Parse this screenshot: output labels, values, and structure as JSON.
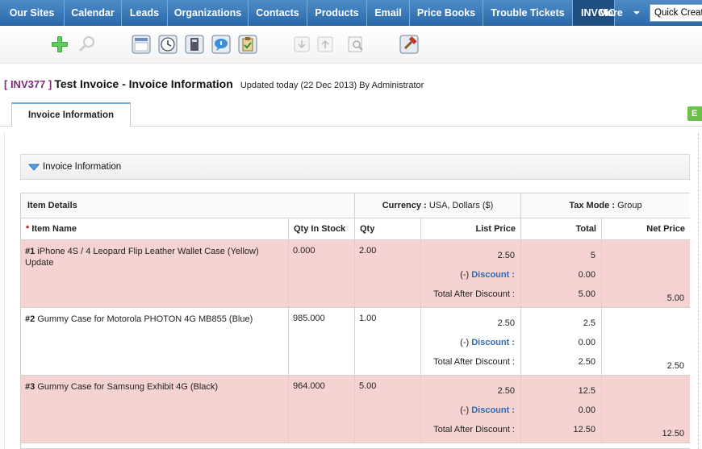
{
  "nav": {
    "tabs": [
      {
        "label": "Our Sites"
      },
      {
        "label": "Calendar"
      },
      {
        "label": "Leads"
      },
      {
        "label": "Organizations"
      },
      {
        "label": "Contacts"
      },
      {
        "label": "Products"
      },
      {
        "label": "Email"
      },
      {
        "label": "Price Books"
      },
      {
        "label": "Trouble Tickets"
      },
      {
        "label": "INVOICE"
      }
    ],
    "more_label": "More",
    "quick_create": "Quick Create"
  },
  "colors": {
    "nav_bg": "#3b7bbf",
    "active_tab": "#1f4f80",
    "highlight_row": "#f5d3d3",
    "record_id": "#7a2a7a",
    "discount_link": "#2e6ab5"
  },
  "toolbar": {
    "icons": [
      "add-icon",
      "search-icon",
      "calendar-icon",
      "clock-icon",
      "calculator-icon",
      "chat-icon",
      "clipboard-icon",
      "import-icon",
      "export-icon",
      "find-duplicates-icon",
      "settings-hammer-icon"
    ]
  },
  "record": {
    "id": "[ INV377 ]",
    "title": "Test Invoice - Invoice Information",
    "updated": "Updated today (22 Dec 2013) By Administrator"
  },
  "tabs": {
    "info": "Invoice Information",
    "edit": "E"
  },
  "section": {
    "title": "Invoice Information"
  },
  "items": {
    "header": {
      "item_details": "Item Details",
      "currency_label": "Currency :",
      "currency_value": "USA, Dollars ($)",
      "taxmode_label": "Tax Mode :",
      "taxmode_value": "Group"
    },
    "columns": {
      "required_mark": "*",
      "item_name": "Item Name",
      "qty_in_stock": "Qty In Stock",
      "qty": "Qty",
      "list_price": "List Price",
      "total": "Total",
      "net_price": "Net Price"
    },
    "labels": {
      "discount_prefix": "(-)",
      "discount": "Discount :",
      "total_after_discount": "Total After Discount :"
    },
    "rows": [
      {
        "num": "#1",
        "name": "iPhone 4S / 4 Leopard Flip Leather Wallet Case (Yellow)",
        "desc": "Update",
        "stock": "0.000",
        "qty": "2.00",
        "list_price": "2.50",
        "total": "5",
        "discount": "0.00",
        "after_discount": "5.00",
        "net": "5.00"
      },
      {
        "num": "#2",
        "name": "Gummy Case for Motorola PHOTON 4G MB855 (Blue)",
        "desc": "",
        "stock": "985.000",
        "qty": "1.00",
        "list_price": "2.50",
        "total": "2.5",
        "discount": "0.00",
        "after_discount": "2.50",
        "net": "2.50"
      },
      {
        "num": "#3",
        "name": "Gummy Case for Samsung Exhibit 4G (Black)",
        "desc": "",
        "stock": "964.000",
        "qty": "5.00",
        "list_price": "2.50",
        "total": "12.5",
        "discount": "0.00",
        "after_discount": "12.50",
        "net": "12.50"
      }
    ]
  }
}
